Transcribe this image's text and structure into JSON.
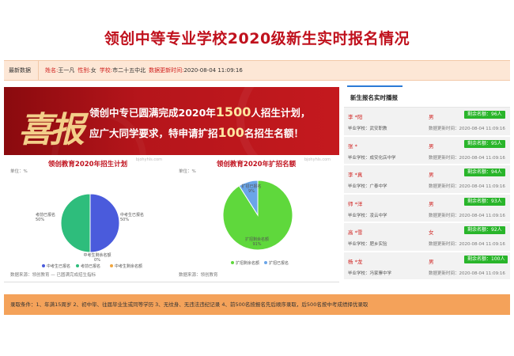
{
  "page_title": "领创中等专业学校2020级新生实时报名情况",
  "info_bar": {
    "latest_label": "最新数据",
    "name_label": "姓名:",
    "name_value": "王一凡",
    "gender_label": "性别:",
    "gender_value": "女",
    "school_label": "学校:",
    "school_value": "市二十五中北",
    "update_label": "数据更新时间:",
    "update_value": "2020-08-04 11:09:16"
  },
  "banner": {
    "headline": "喜报",
    "line1_a": "领创中专已圆满完成2020年",
    "line1_big": "1500",
    "line1_b": "人招生计划，",
    "line2_a": "应广大同学要求，特申请扩招",
    "line2_big": "100",
    "line2_b": "名招生名额！"
  },
  "charts": {
    "watermark": "bjohyhls.com",
    "unit": "单位：%",
    "c1_source": "数据来源：领创教育 — 已圆满完成招生指标",
    "c2_source": "数据来源：领创教育"
  },
  "chart_data": [
    {
      "type": "pie",
      "title": "领创教育2020年招生计划",
      "unit": "单位：%",
      "categories": [
        "中考生已报名",
        "考前已报名",
        "中考生剩余名额"
      ],
      "values": [
        50,
        50,
        0
      ],
      "labels": [
        "中考生已报名\n50%",
        "考前已报名\n50%",
        "中考生剩余名额\n0%"
      ],
      "colors": [
        "#4a5bdc",
        "#2ebd7c",
        "#f0a640"
      ],
      "legend": [
        "中考生已报名",
        "考前已报名",
        "中考生剩余名额"
      ],
      "legend_position": "bottom"
    },
    {
      "type": "pie",
      "title": "领创教育2020年扩招名额",
      "unit": "单位：%",
      "categories": [
        "扩招剩余名额",
        "扩招已报名"
      ],
      "values": [
        91,
        9
      ],
      "labels": [
        "扩招剩余名额\n91%",
        "扩招已报名\n9%"
      ],
      "colors": [
        "#5fd83c",
        "#6aa5e8"
      ],
      "legend": [
        "扩招剩余名额",
        "扩招已报名"
      ],
      "legend_position": "bottom"
    }
  ],
  "feed": {
    "title": "新生报名实时播报",
    "items": [
      {
        "name": "李 *阳",
        "gender": "男",
        "badge": "剩余名额：96人",
        "school": "毕业学校：武安职教",
        "time": "数据更新时间：2020-08-04 11:09:16"
      },
      {
        "name": "张 *",
        "gender": "男",
        "badge": "剩余名额：95人",
        "school": "毕业学校：成安化店中学",
        "time": "数据更新时间：2020-08-04 11:09:16"
      },
      {
        "name": "李 *真",
        "gender": "男",
        "badge": "剩余名额：94人",
        "school": "毕业学校：广泰中学",
        "time": "数据更新时间：2020-08-04 11:09:16"
      },
      {
        "name": "师 *洋",
        "gender": "男",
        "badge": "剩余名额：93人",
        "school": "毕业学校：凌云中学",
        "time": "数据更新时间：2020-08-04 11:09:16"
      },
      {
        "name": "高 *雪",
        "gender": "女",
        "badge": "剩余名额：92人",
        "school": "毕业学校：肥乡实验",
        "time": "数据更新时间：2020-08-04 11:09:16"
      },
      {
        "name": "杨 *龙",
        "gender": "男",
        "badge": "剩余名额：100人",
        "school": "毕业学校：冯家寨中学",
        "time": "数据更新时间：2020-08-04 11:09:16"
      }
    ]
  },
  "footer": {
    "text": "录取条件：1、年满15周岁 2、初中毕、往届毕业生或同等学历 3、无纹身、无违法违纪记录 4、前500名按报名先后顺序录取，后500名按中考成绩择优录取"
  }
}
